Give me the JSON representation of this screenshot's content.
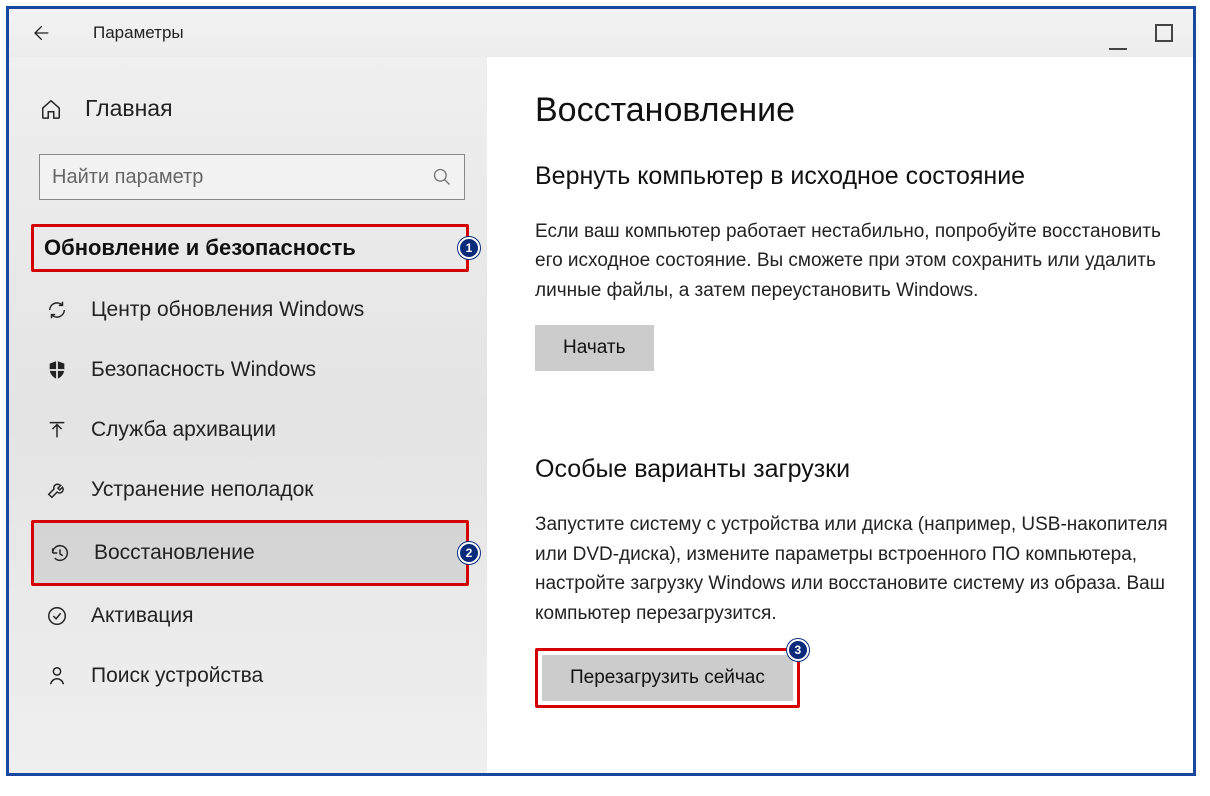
{
  "window": {
    "title": "Параметры"
  },
  "sidebar": {
    "home": "Главная",
    "search_placeholder": "Найти параметр",
    "section": "Обновление и безопасность",
    "items": [
      {
        "label": "Центр обновления Windows",
        "icon": "sync-icon"
      },
      {
        "label": "Безопасность Windows",
        "icon": "shield-icon"
      },
      {
        "label": "Служба архивации",
        "icon": "upload-icon"
      },
      {
        "label": "Устранение неполадок",
        "icon": "wrench-icon"
      },
      {
        "label": "Восстановление",
        "icon": "history-icon"
      },
      {
        "label": "Активация",
        "icon": "check-circle-icon"
      },
      {
        "label": "Поиск устройства",
        "icon": "device-find-icon"
      }
    ]
  },
  "main": {
    "heading": "Восстановление",
    "reset": {
      "title": "Вернуть компьютер в исходное состояние",
      "desc": "Если ваш компьютер работает нестабильно, попробуйте восстановить его исходное состояние. Вы сможете при этом сохранить или удалить личные файлы, а затем переустановить Windows.",
      "button": "Начать"
    },
    "advanced": {
      "title": "Особые варианты загрузки",
      "desc": "Запустите систему с устройства или диска (например, USB-накопителя или DVD-диска), измените параметры встроенного ПО компьютера, настройте загрузку Windows или восстановите систему из образа. Ваш компьютер перезагрузится.",
      "button": "Перезагрузить сейчас"
    }
  },
  "annotations": {
    "b1": "1",
    "b2": "2",
    "b3": "3"
  }
}
